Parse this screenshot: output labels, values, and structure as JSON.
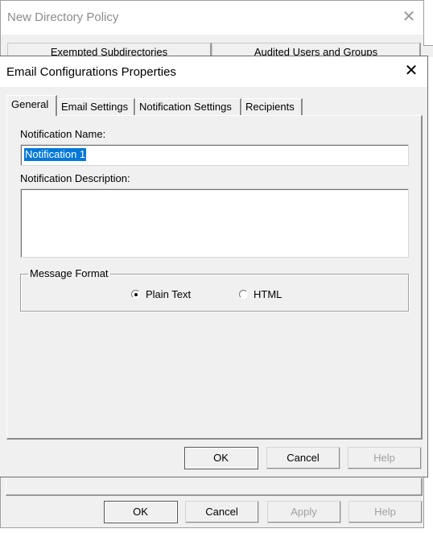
{
  "background_dialog": {
    "title": "New Directory Policy",
    "close_icon": "close-icon",
    "tabs": [
      {
        "label": "Exempted Subdirectories"
      },
      {
        "label": "Audited Users and Groups"
      }
    ],
    "buttons": {
      "ok": "OK",
      "cancel": "Cancel",
      "apply": "Apply",
      "help": "Help"
    }
  },
  "dialog": {
    "title": "Email Configurations Properties",
    "close_icon": "close-icon",
    "tabs": [
      {
        "label": "General",
        "active": true
      },
      {
        "label": "Email Settings",
        "active": false
      },
      {
        "label": "Notification Settings",
        "active": false
      },
      {
        "label": "Recipients",
        "active": false
      }
    ],
    "general": {
      "name_label": "Notification Name:",
      "name_value": "Notification 1",
      "description_label": "Notification Description:",
      "description_value": "",
      "message_format": {
        "legend": "Message Format",
        "options": [
          {
            "label": "Plain Text",
            "checked": true
          },
          {
            "label": "HTML",
            "checked": false
          }
        ]
      }
    },
    "buttons": {
      "ok": "OK",
      "cancel": "Cancel",
      "help": "Help"
    },
    "colors": {
      "selection": "#0078d7",
      "window_bg": "#f0f0f0",
      "titlebar_bg": "#ffffff"
    }
  }
}
